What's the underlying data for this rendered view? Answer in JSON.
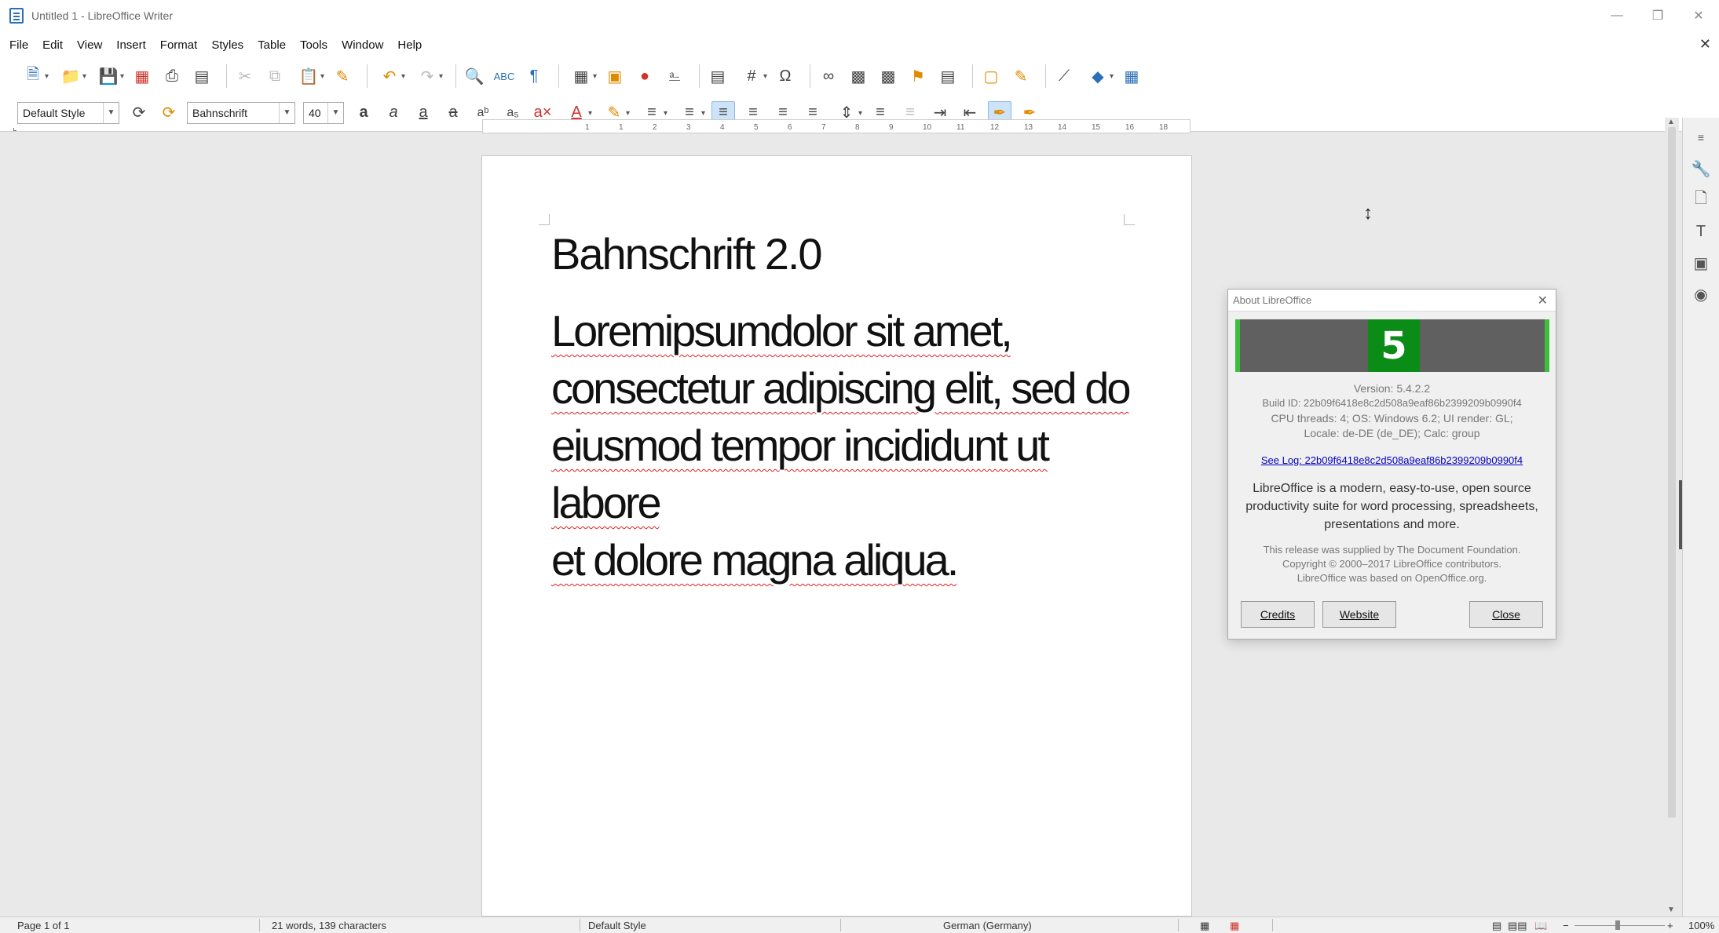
{
  "window": {
    "title": "Untitled 1 - LibreOffice Writer"
  },
  "menu": [
    "File",
    "Edit",
    "View",
    "Insert",
    "Format",
    "Styles",
    "Table",
    "Tools",
    "Window",
    "Help"
  ],
  "formatting": {
    "paragraph_style": "Default Style",
    "font_name": "Bahnschrift",
    "font_size": "40"
  },
  "ruler": {
    "ticks": [
      "1",
      "1",
      "2",
      "3",
      "4",
      "5",
      "6",
      "7",
      "8",
      "9",
      "10",
      "11",
      "12",
      "13",
      "14",
      "15",
      "16",
      "18"
    ]
  },
  "document": {
    "heading": "Bahnschrift 2.0",
    "body_lines": [
      "Loremipsumdolor sit amet,",
      "consectetur adipiscing elit, sed do",
      "eiusmod tempor incididunt ut labore",
      "et dolore magna aliqua."
    ]
  },
  "about_dialog": {
    "title": "About LibreOffice",
    "logo_number": "5",
    "version": "Version: 5.4.2.2",
    "build_id": "Build ID: 22b09f6418e8c2d508a9eaf86b2399209b0990f4",
    "cpu": "CPU threads: 4; OS: Windows 6.2; UI render: GL;",
    "locale": "Locale: de-DE (de_DE); Calc: group",
    "log_link": "See Log: 22b09f6418e8c2d508a9eaf86b2399209b0990f4",
    "description": "LibreOffice is a modern, easy-to-use, open source productivity suite for word processing, spreadsheets, presentations and more.",
    "supplied_by": "This release was supplied by The Document Foundation.",
    "copyright": "Copyright © 2000–2017 LibreOffice contributors.",
    "based_on": "LibreOffice was based on OpenOffice.org.",
    "buttons": {
      "credits": "Credits",
      "website": "Website",
      "close": "Close"
    }
  },
  "statusbar": {
    "page": "Page 1 of 1",
    "words": "21 words, 139 characters",
    "style": "Default Style",
    "language": "German (Germany)",
    "zoom": "100%"
  }
}
